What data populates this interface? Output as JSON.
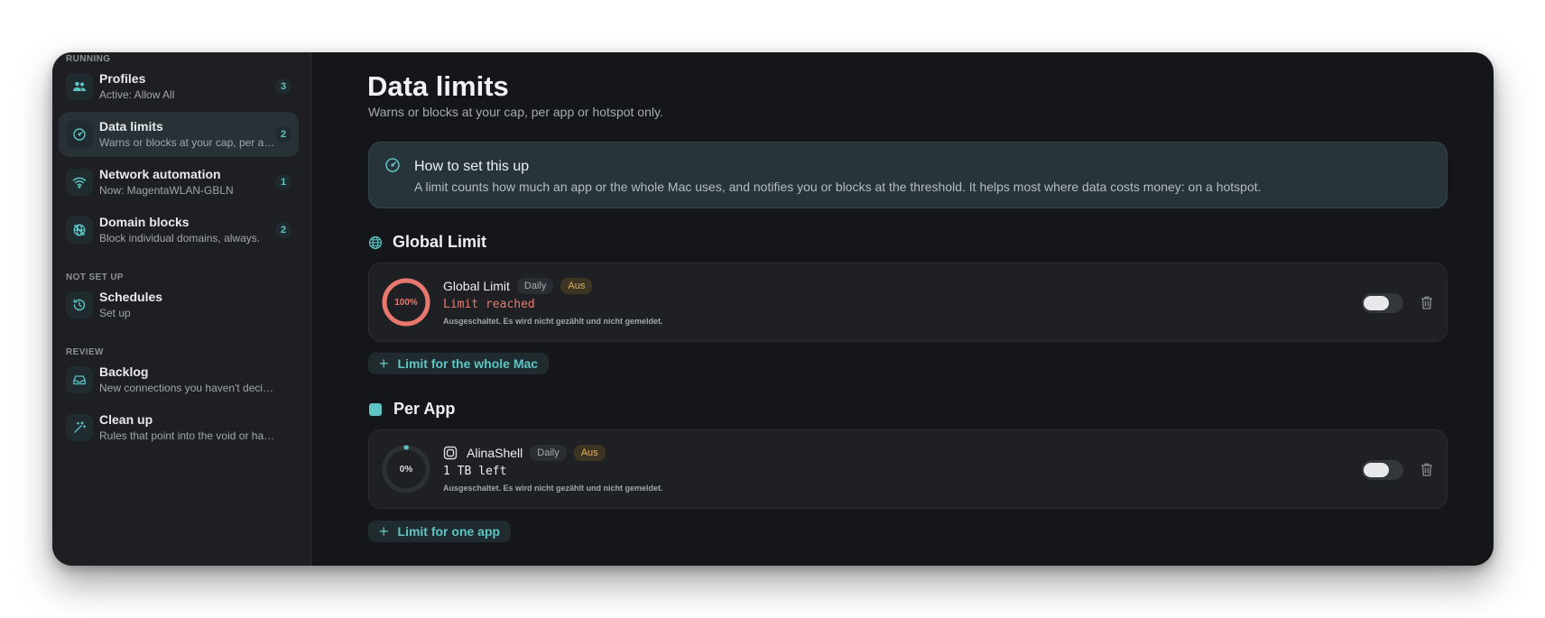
{
  "sidebar": {
    "sections": {
      "running": "RUNNING",
      "not_set_up": "NOT SET UP",
      "review": "REVIEW"
    },
    "items": [
      {
        "title": "Profiles",
        "subtitle": "Active: Allow All",
        "badge": "3",
        "icon": "people-icon"
      },
      {
        "title": "Data limits",
        "subtitle": "Warns or blocks at your cap, per app or hotspot only.",
        "badge": "2",
        "icon": "gauge-icon"
      },
      {
        "title": "Network automation",
        "subtitle": "Now: MagentaWLAN-GBLN",
        "badge": "1",
        "icon": "wifi-icon"
      },
      {
        "title": "Domain blocks",
        "subtitle": "Block individual domains, always.",
        "badge": "2",
        "icon": "blocked-globe-icon"
      },
      {
        "title": "Schedules",
        "subtitle": "Set up",
        "icon": "clock-history-icon"
      },
      {
        "title": "Backlog",
        "subtitle": "New connections you haven't decided on yet.",
        "icon": "inbox-icon"
      },
      {
        "title": "Clean up",
        "subtitle": "Rules that point into the void or have expired.",
        "icon": "magic-wand-icon"
      }
    ]
  },
  "main": {
    "title": "Data limits",
    "subtitle": "Warns or blocks at your cap, per app or hotspot only.",
    "info": {
      "title": "How to set this up",
      "text": "A limit counts how much an app or the whole Mac uses, and notifies you or blocks at the threshold. It helps most where data costs money: on a hotspot."
    },
    "global_section": {
      "title": "Global Limit",
      "card": {
        "name": "Global Limit",
        "period": "Daily",
        "state": "Aus",
        "percent_label": "100%",
        "progress": 1.0,
        "status": "Limit reached",
        "note": "Ausgeschaltet. Es wird nicht gezählt und nicht gemeldet."
      },
      "add_label": "Limit for the whole Mac"
    },
    "app_section": {
      "title": "Per App",
      "card": {
        "name": "AlinaShell",
        "period": "Daily",
        "state": "Aus",
        "percent_label": "0%",
        "progress": 0.0,
        "status": "1 TB left",
        "note": "Ausgeschaltet. Es wird nicht gezählt und nicht gemeldet."
      },
      "add_label": "Limit for one app"
    }
  },
  "colors": {
    "accent": "#5ec4c4",
    "danger": "#e87a70",
    "warning": "#e2b163"
  }
}
